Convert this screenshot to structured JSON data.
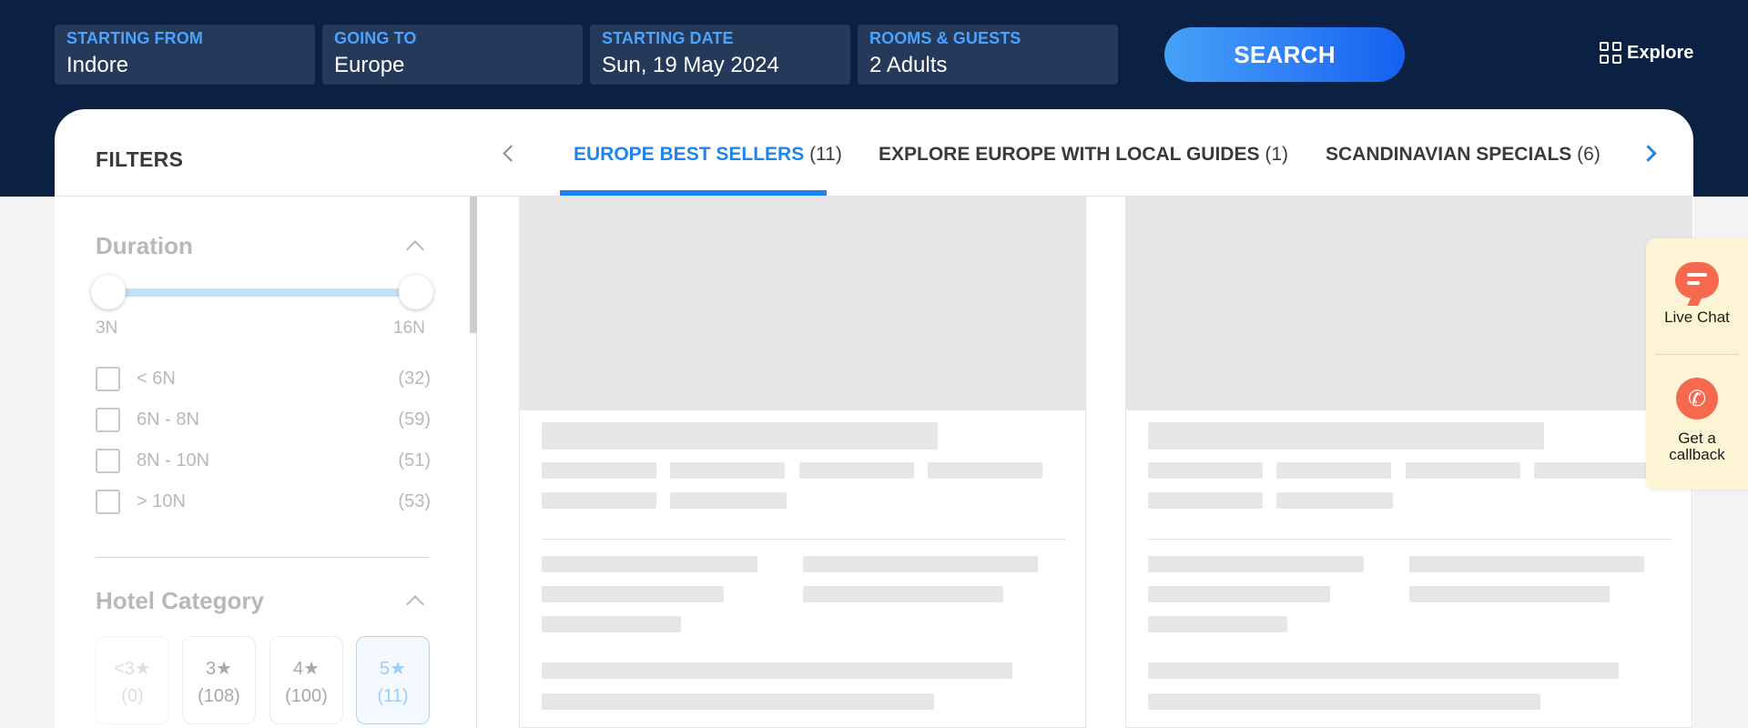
{
  "search": {
    "fields": [
      {
        "label": "STARTING FROM",
        "value": "Indore"
      },
      {
        "label": "GOING TO",
        "value": "Europe"
      },
      {
        "label": "STARTING DATE",
        "value": "Sun, 19 May 2024"
      },
      {
        "label": "ROOMS & GUESTS",
        "value": "2 Adults"
      }
    ],
    "button_label": "SEARCH"
  },
  "header": {
    "explore_label": "Explore"
  },
  "filters": {
    "title": "FILTERS",
    "duration": {
      "title": "Duration",
      "range_min_label": "3N",
      "range_max_label": "16N",
      "selected_range_fraction": [
        0,
        1
      ],
      "options": [
        {
          "label": "< 6N",
          "count": "(32)"
        },
        {
          "label": "6N - 8N",
          "count": "(59)"
        },
        {
          "label": "8N - 10N",
          "count": "(51)"
        },
        {
          "label": "> 10N",
          "count": "(53)"
        }
      ]
    },
    "hotel_category": {
      "title": "Hotel Category",
      "options": [
        {
          "label": "<3★",
          "count": "(0)"
        },
        {
          "label": "3★",
          "count": "(108)"
        },
        {
          "label": "4★",
          "count": "(100)"
        },
        {
          "label": "5★",
          "count": "(11)"
        }
      ]
    }
  },
  "tabs": [
    {
      "label": "EUROPE BEST SELLERS",
      "count": "(11)",
      "active": true
    },
    {
      "label": "EXPLORE EUROPE WITH LOCAL GUIDES",
      "count": "(1)"
    },
    {
      "label": "SCANDINAVIAN SPECIALS",
      "count": "(6)"
    }
  ],
  "support": {
    "live_chat_label": "Live Chat",
    "callback_label": "Get a callback"
  },
  "colors": {
    "header_bg": "#0b2143",
    "accent": "#1e84f0",
    "chat_accent": "#f56a4f"
  }
}
